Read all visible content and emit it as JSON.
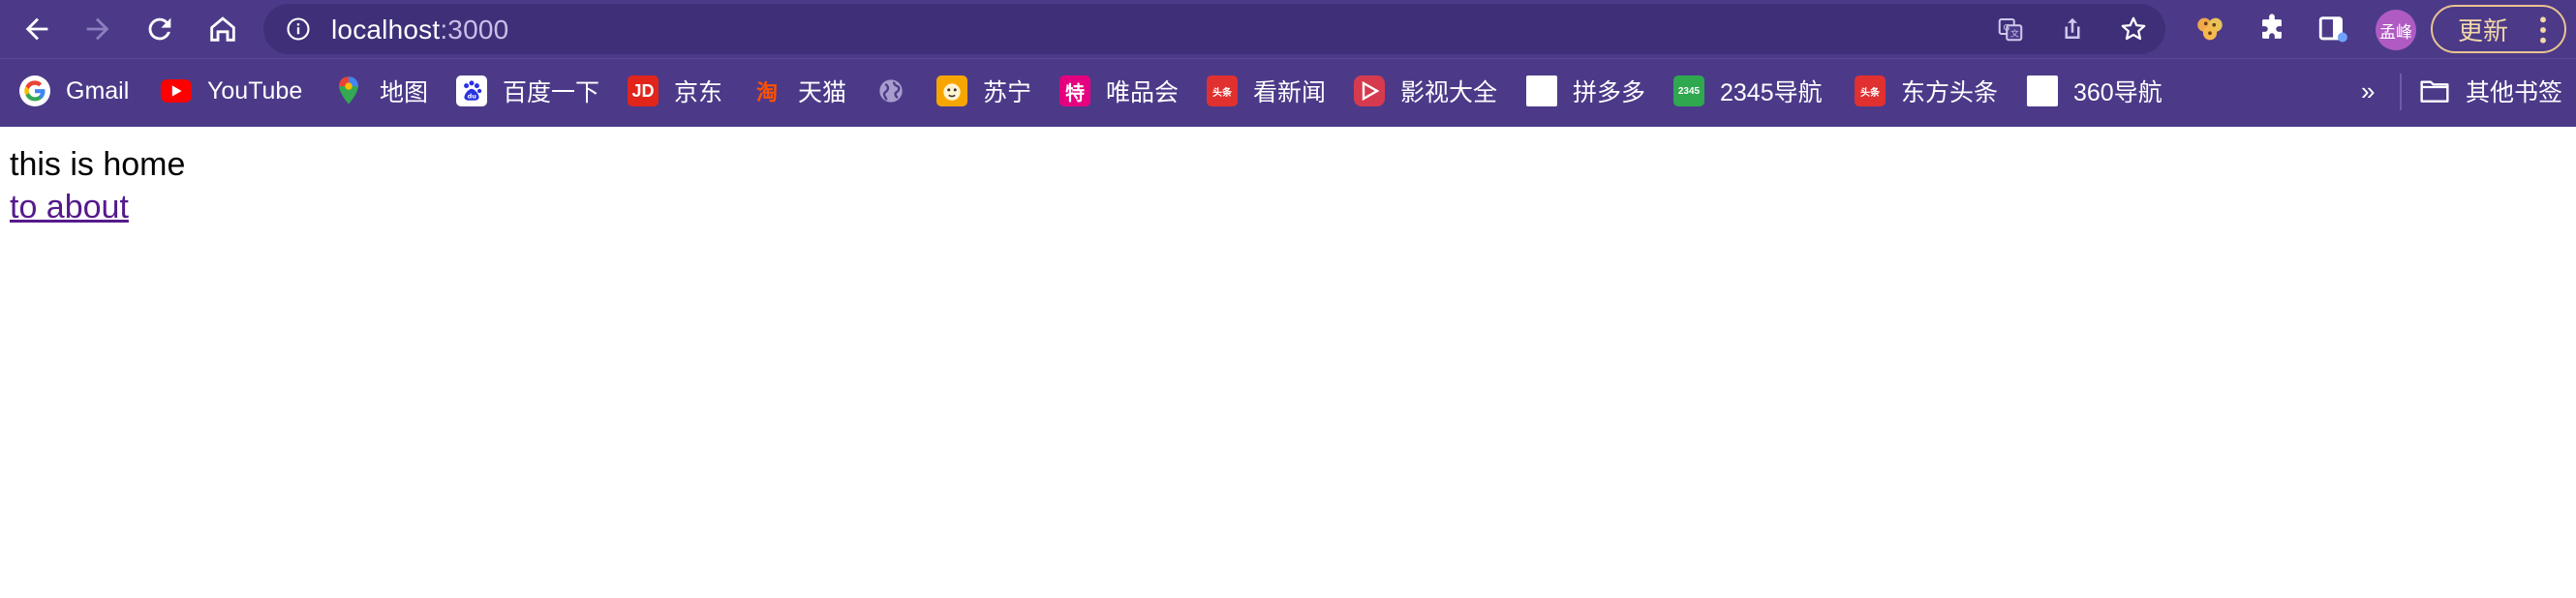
{
  "address_bar": {
    "host": "localhost",
    "port": ":3000"
  },
  "profile": {
    "avatar_text": "孟峰"
  },
  "update_button": {
    "label": "更新"
  },
  "bookmarks": [
    {
      "label": "Gmail",
      "icon": "google-icon"
    },
    {
      "label": "YouTube",
      "icon": "youtube-icon"
    },
    {
      "label": "地图",
      "icon": "maps-pin-icon"
    },
    {
      "label": "百度一下",
      "icon": "baidu-icon"
    },
    {
      "label": "京东",
      "icon": "jd-icon",
      "icon_text": "JD"
    },
    {
      "label": "天猫",
      "icon": "tmall-icon",
      "icon_text": "淘"
    },
    {
      "label": "",
      "icon": "globe-icon"
    },
    {
      "label": "苏宁",
      "icon": "suning-icon"
    },
    {
      "label": "唯品会",
      "icon": "vip-icon",
      "icon_text": "特"
    },
    {
      "label": "看新闻",
      "icon": "toutiao-icon",
      "icon_text": "头条"
    },
    {
      "label": "影视大全",
      "icon": "video-play-icon"
    },
    {
      "label": "拼多多",
      "icon": "blank-page-icon"
    },
    {
      "label": "2345导航",
      "icon": "2345-icon",
      "icon_text": "2345"
    },
    {
      "label": "东方头条",
      "icon": "toutiao-icon",
      "icon_text": "头条"
    },
    {
      "label": "360导航",
      "icon": "blank-page-icon"
    }
  ],
  "bookmarks_overflow": "»",
  "other_bookmarks": {
    "label": "其他书签",
    "icon": "folder-icon"
  },
  "page": {
    "text": "this is home",
    "link": "to about"
  },
  "colors": {
    "toolbar_bg": "#4c3a89",
    "omnibox_bg": "#3f2f78",
    "link": "#551a8b",
    "update_border": "#e9c48f"
  }
}
